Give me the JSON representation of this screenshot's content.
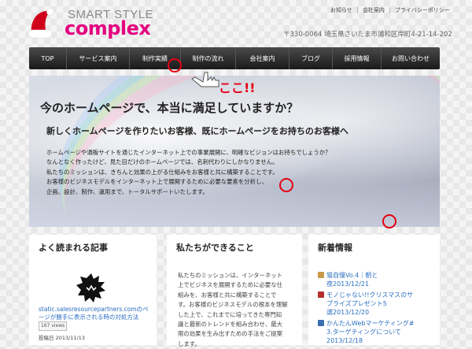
{
  "top_links": [
    "お知らせ",
    "会社案内",
    "プライバシーポリシー"
  ],
  "logo": {
    "smart": "SMART STYLE",
    "complex": "complex"
  },
  "address": "〒330-0064 埼玉県さいたま市浦和区岸町4-21-14-202",
  "nav": [
    "TOP",
    "サービス案内",
    "制作実績",
    "制作の流れ",
    "会社案内",
    "ブログ",
    "採用情報",
    "お問い合わせ"
  ],
  "hero": {
    "title": "今のホームページで、本当に満足していますか？",
    "subtitle": "新しくホームページを作りたいお客様、既にホームページをお持ちのお客様へ",
    "body": [
      "ホームページや通販サイトを通じたインターネット上での事業展開に、明確なビジョンはお持ちでしょうか？",
      "なんとなく作ったけど、見た目だけのホームページでは、名刺代わりにしかなりません。",
      "私たちのミッションは、きちんと効果の上がる仕組みをお客様と共に構築することです。",
      "お客様のビジネスモデルをインターネット上で展開するために必要な要素を分析し、",
      "企画、設計、制作、運用まで、トータルサポートいたします。"
    ],
    "callout": "ここ!!"
  },
  "col1": {
    "title": "よく読まれる記事",
    "post_title": "static.salesresourcepartners.comのページが勝手に表示される時の対処方法",
    "views": "167 views",
    "date": "投稿日 2013/11/13"
  },
  "col2": {
    "title": "私たちができること",
    "body": [
      "私たちのミッションは、インターネット",
      "上でビジネスを展開するために必要な仕",
      "組みを、お客様と共に構築することで",
      "す。お客様のビジネスモデルの根本を理解",
      "した上で、これまでに培ってきた専門知",
      "識と最新のトレンドを組み合わせ、最大",
      "限の効果を生み出すための手法をご提案",
      "します。"
    ]
  },
  "col3": {
    "title": "新着情報",
    "items": [
      {
        "lines": [
          "猫自慢Vo.4｜朝と",
          "夜2013/12/21"
        ],
        "thumb_color": "#c79a4a"
      },
      {
        "lines": [
          "モノじゃない!!クリスマスのサ",
          "プライズプレゼント5",
          "選2013/12/20"
        ],
        "thumb_color": "#b5312d"
      },
      {
        "lines": [
          "かんたんWebマーケティング#",
          "3.ターゲティングについて2013/12/18"
        ],
        "thumb_color": "#3c6fb0"
      }
    ]
  },
  "colors": {
    "accent": "#e4007f",
    "link": "#2a6fc0",
    "mark": "#e60012"
  }
}
